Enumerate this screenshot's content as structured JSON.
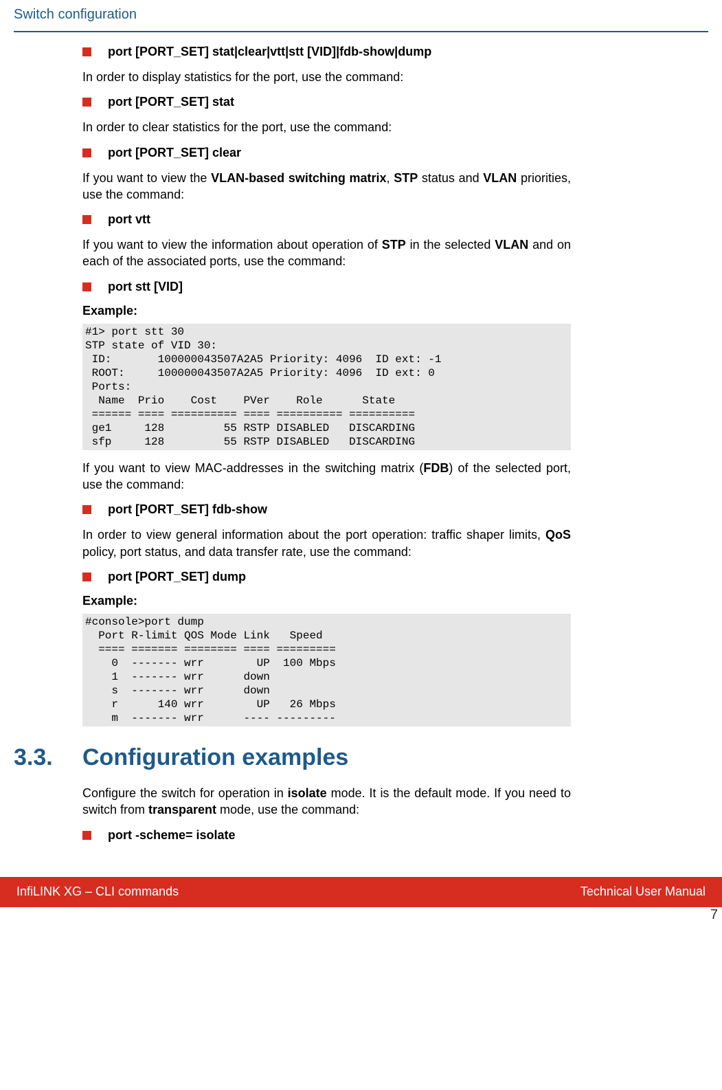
{
  "header": {
    "title": "Switch configuration"
  },
  "commands": {
    "c1": "port [PORT_SET] stat|clear|vtt|stt [VID]|fdb-show|dump",
    "c2": "port [PORT_SET] stat",
    "c3": "port [PORT_SET] clear",
    "c4": "port vtt",
    "c5": "port stt [VID]",
    "c6": "port [PORT_SET] fdb-show",
    "c7": "port [PORT_SET] dump",
    "c8": "port -scheme= isolate"
  },
  "text": {
    "p1": "In order to display statistics for the port, use the command:",
    "p2": "In order to clear statistics for the port, use the command:",
    "p3a": "If you want to view the ",
    "p3b": "VLAN-based switching matrix",
    "p3c": ", ",
    "p3d": "STP",
    "p3e": " status and ",
    "p3f": "VLAN",
    "p3g": " priorities, use the command:",
    "p4a": "If you want to view the information about operation of ",
    "p4b": "STP",
    "p4c": " in the selected ",
    "p4d": "VLAN",
    "p4e": " and on each of the associated ports, use the command:",
    "p5a": "If you want to view MAC-addresses in the switching matrix (",
    "p5b": "FDB",
    "p5c": ") of the selected port, use the command:",
    "p6a": "In order to view general information about the port operation: traffic shaper limits, ",
    "p6b": "QoS",
    "p6c": " policy, port status, and data transfer rate, use the command:",
    "p7a": "Configure the switch for operation in ",
    "p7b": "isolate",
    "p7c": " mode. It is the default mode. If you need to switch from ",
    "p7d": "transparent",
    "p7e": " mode, use the command:"
  },
  "labels": {
    "example": "Example:"
  },
  "code": {
    "ex1": "#1> port stt 30\nSTP state of VID 30:\n ID:       100000043507A2A5 Priority: 4096  ID ext: -1\n ROOT:     100000043507A2A5 Priority: 4096  ID ext: 0\n Ports:\n  Name  Prio    Cost    PVer    Role      State\n ====== ==== ========== ==== ========== ==========\n ge1     128         55 RSTP DISABLED   DISCARDING\n sfp     128         55 RSTP DISABLED   DISCARDING",
    "ex2": "#console>port dump\n  Port R-limit QOS Mode Link   Speed\n  ==== ======= ======== ==== =========\n    0  ------- wrr        UP  100 Mbps\n    1  ------- wrr      down\n    s  ------- wrr      down\n    r      140 wrr        UP   26 Mbps\n    m  ------- wrr      ---- ---------"
  },
  "section": {
    "num": "3.3.",
    "title": "Configuration examples"
  },
  "footer": {
    "left": "InfiLINK XG – CLI commands",
    "right": "Technical User Manual",
    "page": "7"
  }
}
